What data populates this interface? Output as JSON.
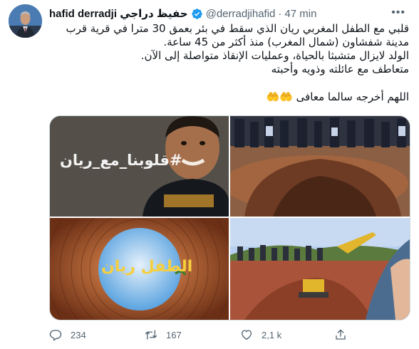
{
  "tweet": {
    "display_name": "hafid derradji حفيظ دراجي",
    "handle": "@derradjihafid",
    "separator": "·",
    "time": "47 min",
    "more_icon": "more-dots-icon",
    "text_lines": [
      "قلبي مع الطفل المغربي ريان الذي سقط في بئر بعمق 30 مترا في قرية قرب مدينة شفشاون (شمال المغرب) منذ أكثر من 45 ساعة.",
      "الولد لايزال متشبثا بالحياة، وعمليات الإنقاذ متواصلة إلى الآن.",
      "متعاطف مع عائلته وذويه وأحبته"
    ],
    "prayer": "اللهم أخرجه سالما معافى 🤲🤲",
    "media": {
      "hashtag_overlay": "#قلوبنا_مع_ريان",
      "well_overlay": "الطفل ريان"
    },
    "actions": {
      "reply_count": "234",
      "retweet_count": "167",
      "like_count": "2,1 k"
    },
    "colors": {
      "verified": "#1d9bf0",
      "muted": "#536471",
      "text": "#0f1419"
    }
  }
}
